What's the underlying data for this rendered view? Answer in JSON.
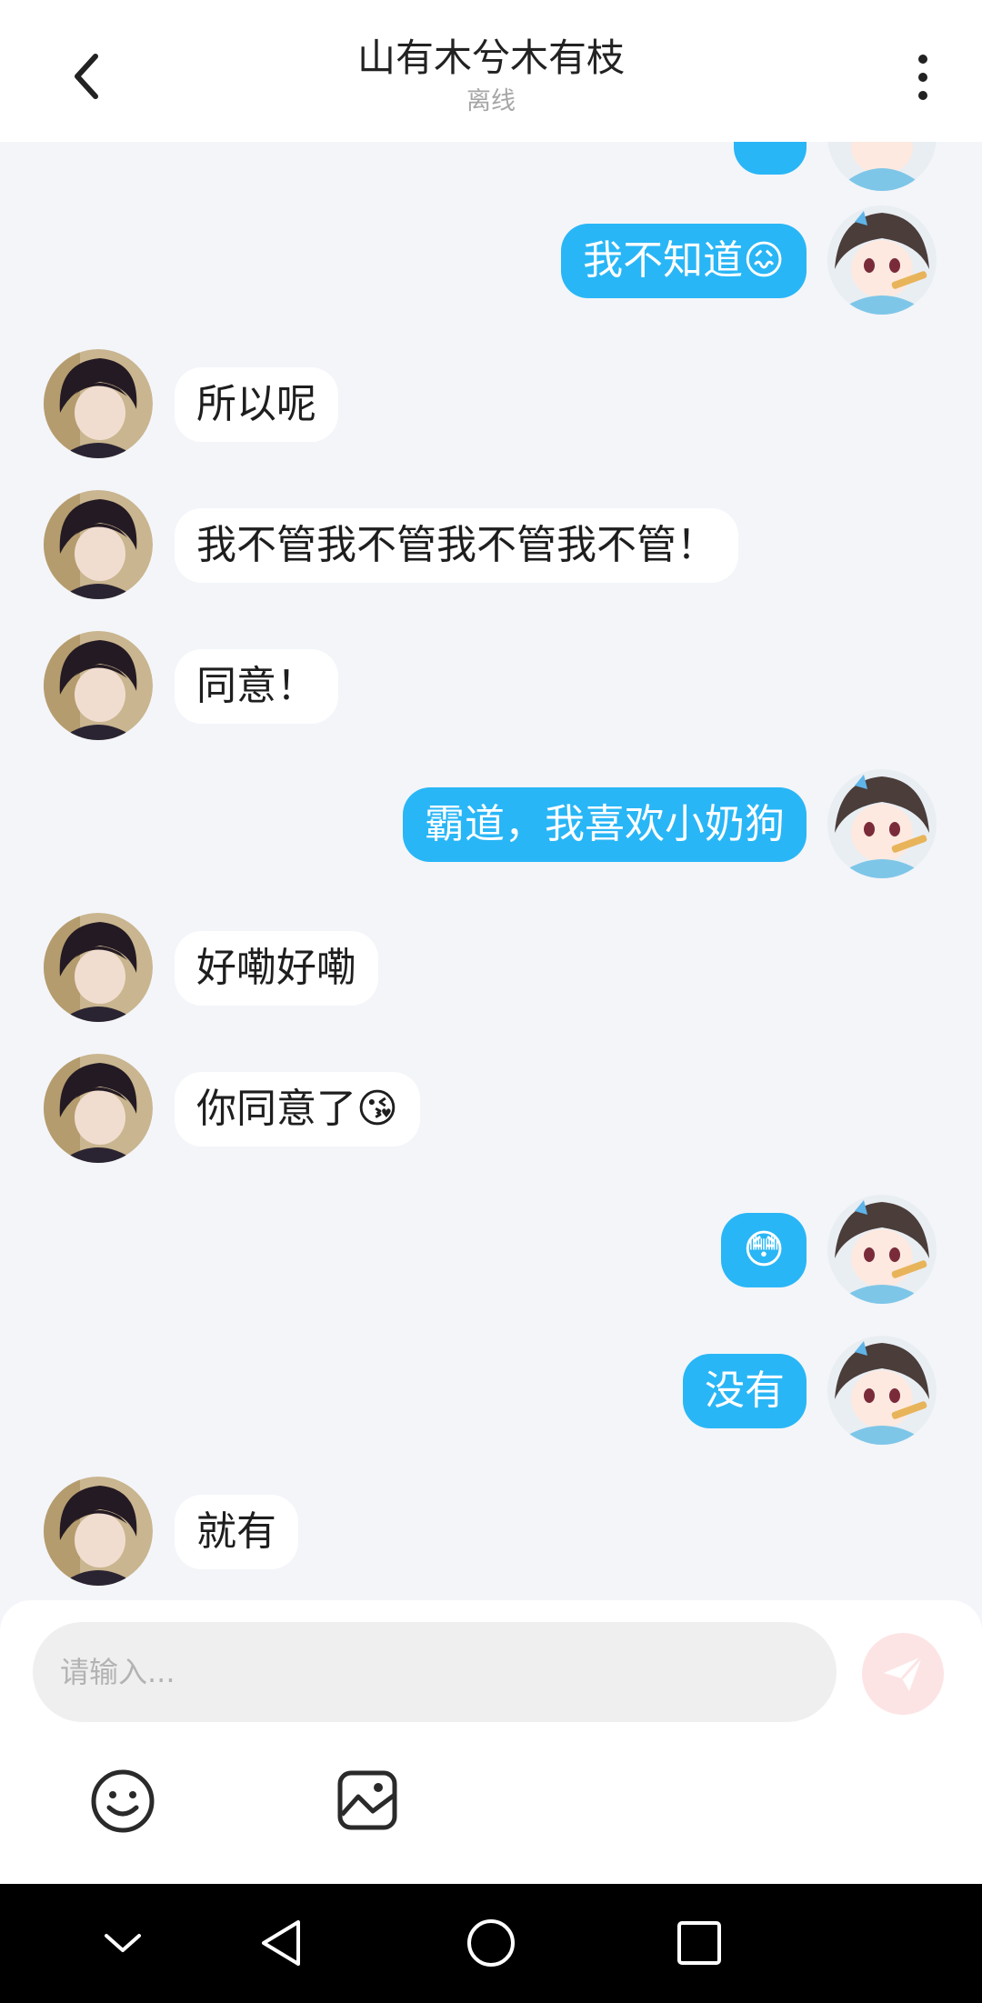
{
  "header": {
    "title": "山有木兮木有枝",
    "status": "离线"
  },
  "messages": [
    {
      "side": "right",
      "text": "我不知道",
      "emoji": "😖"
    },
    {
      "side": "left",
      "text": "所以呢",
      "emoji": ""
    },
    {
      "side": "left",
      "text": "我不管我不管我不管我不管！",
      "emoji": ""
    },
    {
      "side": "left",
      "text": "同意！",
      "emoji": ""
    },
    {
      "side": "right",
      "text": "霸道，我喜欢小奶狗",
      "emoji": ""
    },
    {
      "side": "left",
      "text": "好嘞好嘞",
      "emoji": ""
    },
    {
      "side": "left",
      "text": "你同意了",
      "emoji": "😘"
    },
    {
      "side": "right",
      "text": "",
      "emoji": "😳"
    },
    {
      "side": "right",
      "text": "没有",
      "emoji": ""
    },
    {
      "side": "left",
      "text": "就有",
      "emoji": ""
    }
  ],
  "input": {
    "placeholder": "请输入...",
    "value": ""
  },
  "icons": {
    "back": "chevron-left-icon",
    "more": "more-vertical-icon",
    "send": "send-plane-icon",
    "emoji": "smiley-icon",
    "image": "image-icon",
    "nav_down": "chevron-down-icon",
    "nav_back": "triangle-back-icon",
    "nav_home": "circle-home-icon",
    "nav_recent": "square-recent-icon"
  },
  "colors": {
    "accent": "#29b6f6",
    "background": "#f3f5f9",
    "send_button": "#fde4e4"
  }
}
